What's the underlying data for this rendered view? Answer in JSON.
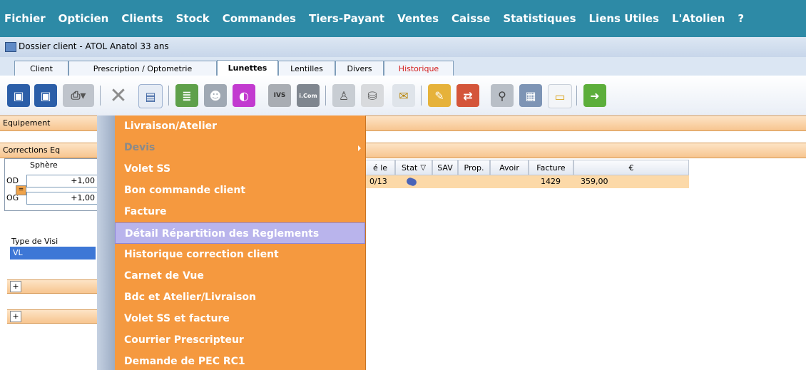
{
  "menubar": {
    "items": [
      "Fichier",
      "Opticien",
      "Clients",
      "Stock",
      "Commandes",
      "Tiers-Payant",
      "Ventes",
      "Caisse",
      "Statistiques",
      "Liens Utiles",
      "L'Atolien",
      "?"
    ]
  },
  "window": {
    "title": "Dossier client - ATOL Anatol 33 ans"
  },
  "tabs": [
    {
      "label": "Client"
    },
    {
      "label": "Prescription / Optometrie"
    },
    {
      "label": "Lunettes"
    },
    {
      "label": "Lentilles"
    },
    {
      "label": "Divers"
    },
    {
      "label": "Historique"
    }
  ],
  "toolbar": {
    "icons": [
      "save-icon",
      "save-as-icon",
      "print-icon",
      "delete-icon",
      "document-icon",
      "list-icon",
      "people-icon",
      "card-icon",
      "ivs-icon",
      "icom-icon",
      "user-icon",
      "bag-icon",
      "envelope-icon",
      "edit-icon",
      "transfer-icon",
      "search-icon",
      "calculator-icon",
      "report-icon",
      "exit-icon"
    ],
    "labels": {
      "ivs": "IVS",
      "icom": "i.Com"
    }
  },
  "content": {
    "equipement_label": "Equipement",
    "corrections_label": "Corrections Eq",
    "sphere_label": "Sphère",
    "od_label": "OD",
    "og_label": "OG",
    "eq_button": "=",
    "od_value": "+1,00",
    "og_value": "+1,00",
    "type_vision_label": "Type de Visi",
    "type_vision_value": "VL",
    "expand_1": "+",
    "expand_2": "+"
  },
  "grid": {
    "headers": [
      "é le",
      "Stat",
      "SAV",
      "Prop.",
      "Avoir",
      "Facture",
      "€"
    ],
    "row": {
      "date": "0/13",
      "facture": "1429",
      "montant": "359,00"
    }
  },
  "dropdown": {
    "items": [
      {
        "label": "Livraison/Atelier",
        "disabled": false
      },
      {
        "label": "Devis",
        "disabled": true,
        "submenu": true
      },
      {
        "label": "Volet SS",
        "disabled": false
      },
      {
        "label": "Bon commande client",
        "disabled": false
      },
      {
        "label": "Facture",
        "disabled": false
      },
      {
        "label": "Détail Répartition des Reglements",
        "disabled": false,
        "hover": true
      },
      {
        "label": "Historique correction client",
        "disabled": false
      },
      {
        "label": "Carnet de Vue",
        "disabled": false
      },
      {
        "label": "Bdc et Atelier/Livraison",
        "disabled": false
      },
      {
        "label": "Volet SS et facture",
        "disabled": false
      },
      {
        "label": "Courrier Prescripteur",
        "disabled": false
      },
      {
        "label": "Demande de PEC RC1",
        "disabled": false
      }
    ]
  },
  "colors": {
    "menubar": "#2d8aa6",
    "dropdown": "#f5993f",
    "hover": "#b9b4ec",
    "orange_band": "#f7c58f"
  }
}
